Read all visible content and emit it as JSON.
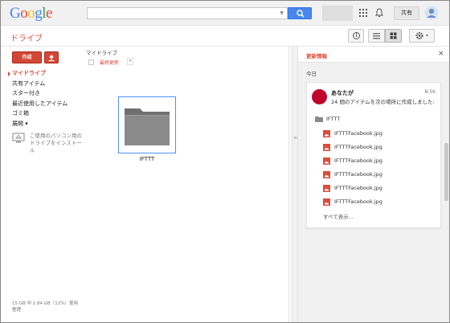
{
  "header": {
    "logo": "Google",
    "search": {
      "value": "",
      "placeholder": ""
    },
    "share_label": "共有"
  },
  "toolbar": {
    "title": "ドライブ"
  },
  "sidebar": {
    "create_label": "作成",
    "items": [
      {
        "label": "マイドライブ",
        "active": true
      },
      {
        "label": "共有アイテム",
        "active": false
      },
      {
        "label": "スター付き",
        "active": false
      },
      {
        "label": "最近使用したアイテム",
        "active": false
      },
      {
        "label": "ゴミ箱",
        "active": false
      },
      {
        "label": "展開 ▾",
        "active": false
      }
    ],
    "install_text": "ご使用のパソコン用のドライブをインストール",
    "storage_line1": "15 GB 中 1.84 GB（12%）使用",
    "storage_line2": "整理"
  },
  "main": {
    "breadcrumb": "マイドライブ",
    "sort_label": "最終更新",
    "folders": [
      {
        "name": "IFTTT"
      }
    ]
  },
  "activity": {
    "title": "更新情報",
    "day": "今日",
    "card": {
      "actor": "あなたが",
      "time": "8:56",
      "description": "24 個のアイテムを次の場所に作成しました:",
      "folder": "IFTTT",
      "files": [
        "IFTTTFacebook.jpg",
        "IFTTTFacebook.jpg",
        "IFTTTFacebook.jpg",
        "IFTTTFacebook.jpg",
        "IFTTTFacebook.jpg",
        "IFTTTFacebook.jpg"
      ],
      "show_all": "すべて表示..."
    }
  },
  "colors": {
    "brand_red": "#dd4b39",
    "search_blue": "#4787ed",
    "avatar": "#c0002a",
    "file_icon": "#dd4b39"
  }
}
